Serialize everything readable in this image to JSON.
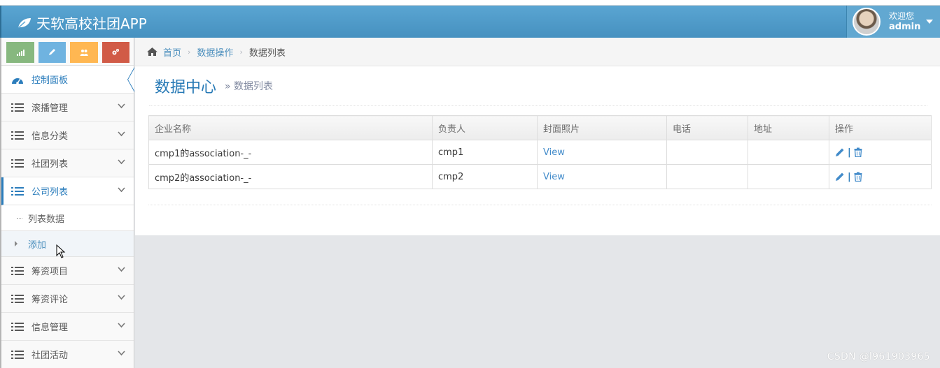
{
  "app": {
    "title": "天软高校社团APP"
  },
  "user": {
    "greeting": "欢迎您",
    "name": "admin"
  },
  "sidebar": {
    "items": [
      {
        "label": "控制面板"
      },
      {
        "label": "滚播管理"
      },
      {
        "label": "信息分类"
      },
      {
        "label": "社团列表"
      },
      {
        "label": "公司列表"
      },
      {
        "label": "筹资项目"
      },
      {
        "label": "筹资评论"
      },
      {
        "label": "信息管理"
      },
      {
        "label": "社团活动"
      }
    ],
    "sub_items": [
      {
        "label": "列表数据"
      },
      {
        "label": "添加"
      }
    ]
  },
  "breadcrumb": {
    "home": "首页",
    "section": "数据操作",
    "current": "数据列表"
  },
  "page_header": {
    "title": "数据中心",
    "subtitle": "» 数据列表"
  },
  "table": {
    "headers": [
      "企业名称",
      "负责人",
      "封面照片",
      "电话",
      "地址",
      "操作"
    ],
    "rows": [
      {
        "name": "cmp1的association-_-",
        "owner": "cmp1",
        "photo": "View",
        "phone": "",
        "address": ""
      },
      {
        "name": "cmp2的association-_-",
        "owner": "cmp2",
        "photo": "View",
        "phone": "",
        "address": ""
      }
    ],
    "op_separator": "|"
  },
  "watermark": "CSDN @l961903965",
  "colors": {
    "navbar": "#438eb9",
    "accent": "#2b7dbc",
    "link": "#428bca",
    "shortcut_green": "#87b87f",
    "shortcut_blue": "#6fb3e0",
    "shortcut_yellow": "#ffb752",
    "shortcut_red": "#d15b47"
  }
}
